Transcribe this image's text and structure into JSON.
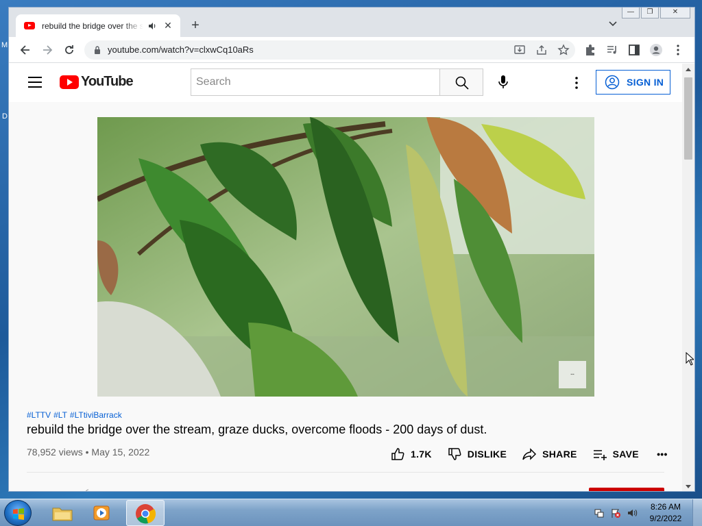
{
  "desktop": {
    "fragments": [
      "M",
      "D"
    ]
  },
  "browser": {
    "tab": {
      "title": "rebuild the bridge over the stream, graze ducks, overcome floods - 200 days of dust. - YouTube",
      "new_tab_symbol": "+",
      "close_symbol": "✕"
    },
    "window_controls": {
      "minimize": "—",
      "restore": "❐",
      "close": "✕"
    },
    "url": "youtube.com/watch?v=clxwCq10aRs"
  },
  "youtube": {
    "logo_text": "YouTube",
    "search": {
      "placeholder": "Search",
      "value": ""
    },
    "sign_in_label": "SIGN IN",
    "video": {
      "hashtags": [
        "#LTTV",
        "#LT",
        "#LTtiviBarrack"
      ],
      "title": "rebuild the bridge over the stream, graze ducks, overcome floods - 200 days of dust.",
      "views": "78,952 views",
      "separator": "•",
      "date": "May 15, 2022",
      "likes": "1.7K",
      "dislike_label": "DISLIKE",
      "share_label": "SHARE",
      "save_label": "SAVE",
      "more_label": "•••"
    }
  },
  "taskbar": {
    "apps": [
      "windows-explorer",
      "media-player",
      "google-chrome"
    ],
    "clock": {
      "time": "8:26 AM",
      "date": "9/2/2022"
    }
  },
  "colors": {
    "youtube_red": "#ff0000",
    "link_blue": "#065fd4",
    "taskbar": "#7ea3c9"
  }
}
